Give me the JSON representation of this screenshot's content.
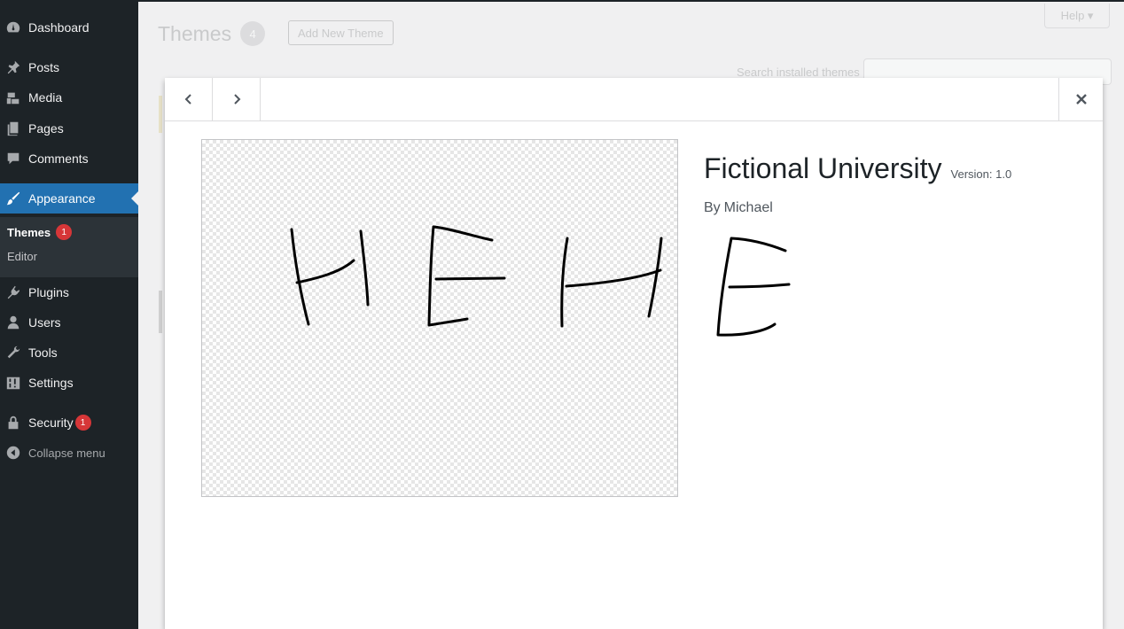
{
  "sidebar": {
    "items": [
      {
        "label": "Dashboard",
        "icon": "dashboard-icon"
      },
      {
        "label": "Posts",
        "icon": "pin-icon"
      },
      {
        "label": "Media",
        "icon": "media-icon"
      },
      {
        "label": "Pages",
        "icon": "pages-icon"
      },
      {
        "label": "Comments",
        "icon": "comment-icon"
      },
      {
        "label": "Appearance",
        "icon": "brush-icon",
        "active": true
      },
      {
        "label": "Plugins",
        "icon": "plugin-icon"
      },
      {
        "label": "Users",
        "icon": "user-icon"
      },
      {
        "label": "Tools",
        "icon": "wrench-icon"
      },
      {
        "label": "Settings",
        "icon": "settings-icon"
      },
      {
        "label": "Security",
        "icon": "lock-icon",
        "badge": "1"
      }
    ],
    "submenu": [
      {
        "label": "Themes",
        "badge": "1",
        "current": true
      },
      {
        "label": "Editor"
      }
    ],
    "collapse_label": "Collapse menu"
  },
  "background": {
    "title": "Themes",
    "count": "4",
    "add_new_label": "Add New Theme",
    "help_label": "Help ▾",
    "search_label": "Search installed themes"
  },
  "modal": {
    "theme_name": "Fictional University",
    "version": "Version: 1.0",
    "author_prefix": "By",
    "author": "Michael",
    "screenshot_text": "HEHE",
    "description_text": "E"
  },
  "colors": {
    "sidebar_bg": "#1d2327",
    "accent": "#2271b1",
    "badge": "#d63638"
  }
}
